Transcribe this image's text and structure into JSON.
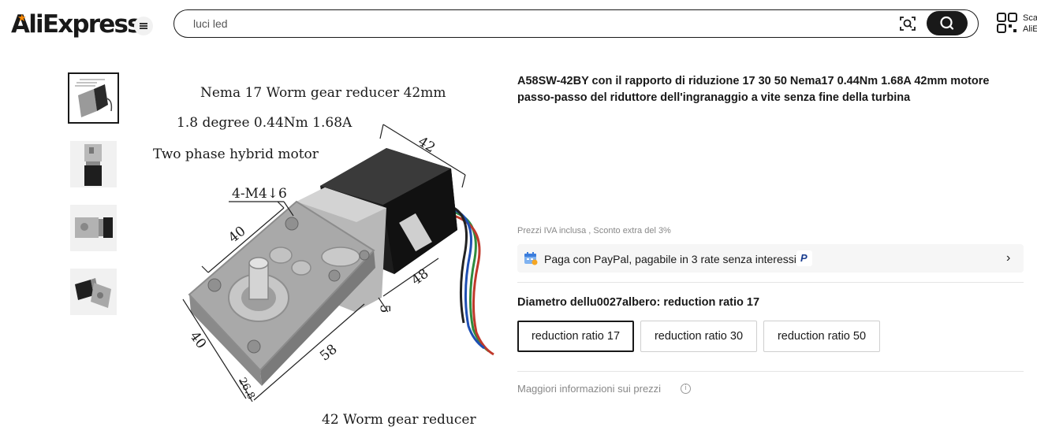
{
  "header": {
    "logo": "AliExpress",
    "search": {
      "value": "luci led",
      "placeholder": ""
    },
    "qr_text_line1": "Sca",
    "qr_text_line2": "AliE"
  },
  "gallery": {
    "thumbnails": [
      {
        "name": "thumb-1",
        "active": true
      },
      {
        "name": "thumb-2",
        "active": false
      },
      {
        "name": "thumb-3",
        "active": false
      },
      {
        "name": "thumb-4",
        "active": false
      }
    ],
    "image_text": {
      "line1": "Nema 17 Worm gear reducer 42mm",
      "line2": "1.8 degree 0.44Nm 1.68A",
      "line3": "Two phase hybrid motor",
      "screw": "4-M4↓6",
      "dim_42": "42",
      "dim_40_top": "40",
      "dim_48": "48",
      "dim_5": "5",
      "dim_40_left": "40",
      "dim_58": "58",
      "dim_26_8": "26.8",
      "bottom": "42 Worm gear reducer"
    }
  },
  "product": {
    "title": "A58SW-42BY con il rapporto di riduzione 17 30 50 Nema17 0.44Nm 1.68A 42mm motore passo-passo del riduttore dell'ingranaggio a vite senza fine della turbina",
    "tax_note": "Prezzi IVA inclusa , Sconto extra del 3%",
    "paypal_text": "Paga con PayPal, pagabile in 3 rate senza interessi.",
    "paypal_logo": "P",
    "option_label": "Diametro dellu0027albero: reduction ratio 17",
    "options": [
      "reduction ratio 17",
      "reduction ratio 30",
      "reduction ratio 50"
    ],
    "selected_option": "reduction ratio 17",
    "more_info": "Maggiori informazioni sui prezzi",
    "info_glyph": "i"
  },
  "colors": {
    "brand_orange": "#ff8a00",
    "text": "#191919",
    "paypal_blue": "#1a3d8f"
  }
}
